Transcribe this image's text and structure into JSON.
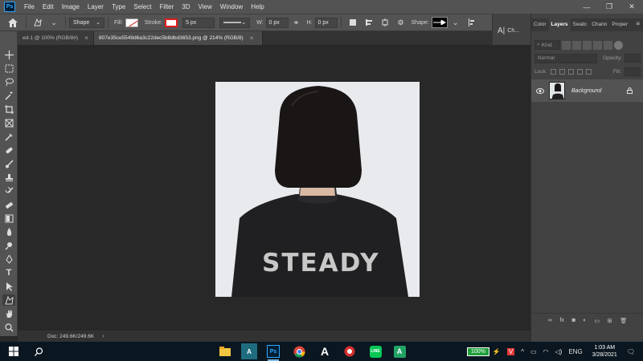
{
  "app": {
    "logo": "Ps"
  },
  "menu": [
    "File",
    "Edit",
    "Image",
    "Layer",
    "Type",
    "Select",
    "Filter",
    "3D",
    "View",
    "Window",
    "Help"
  ],
  "window_controls": {
    "minimize": "—",
    "maximize": "❐",
    "close": "✕"
  },
  "options": {
    "mode": "Shape",
    "fill_label": "Fill:",
    "stroke_label": "Stroke:",
    "stroke_width": "5 px",
    "w_label": "W:",
    "w_value": "0 px",
    "h_label": "H:",
    "h_value": "0 px",
    "shape_label": "Shape:"
  },
  "mini_panel": {
    "item": "Ch..."
  },
  "doc_tabs": [
    {
      "label": "ed-1 @ 100% (RGB/8#)",
      "close": "×"
    },
    {
      "label": "807e35ce5549d6a3c22dec5b8dbd3653.png @ 214% (RGB/8)",
      "close": "×"
    }
  ],
  "artwork": {
    "shirt_text": "STEADY"
  },
  "status": {
    "doc": "Doc: 249.6K/249.6K"
  },
  "panels": {
    "tabs": [
      "Color",
      "Layers",
      "Swatc",
      "Chann",
      "Proper"
    ],
    "active_tab": "Layers",
    "kind_placeholder": "Kind",
    "blend_mode": "Normal",
    "opacity_label": "Opacity:",
    "lock_label": "Lock:",
    "fill_label": "Fill:",
    "layers": [
      {
        "name": "Background",
        "visible": true,
        "locked": true
      }
    ],
    "footer_icons": [
      "link-icon",
      "fx-icon",
      "mask-icon",
      "adjustment-icon",
      "group-icon",
      "new-layer-icon",
      "trash-icon"
    ]
  },
  "taskbar": {
    "battery": "100%",
    "language": "ENG",
    "time": "1:03 AM",
    "date": "3/28/2021"
  },
  "colors": {
    "accent": "#31a8ff",
    "stroke": "#e01e1e",
    "battery": "#1f9e3b"
  }
}
